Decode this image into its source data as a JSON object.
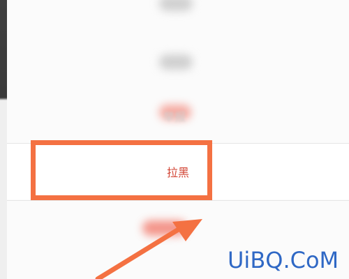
{
  "menu": {
    "items": [
      {
        "label": "举报",
        "style": "blurred"
      },
      {
        "label": "拉黑",
        "style": "highlighted"
      }
    ]
  },
  "annotation": {
    "color": "#f47142"
  },
  "watermark": {
    "text": "UiBQ.CoM",
    "color": "#2f68c5"
  },
  "colors": {
    "accent": "#d24434",
    "background": "#fbfbfb"
  }
}
